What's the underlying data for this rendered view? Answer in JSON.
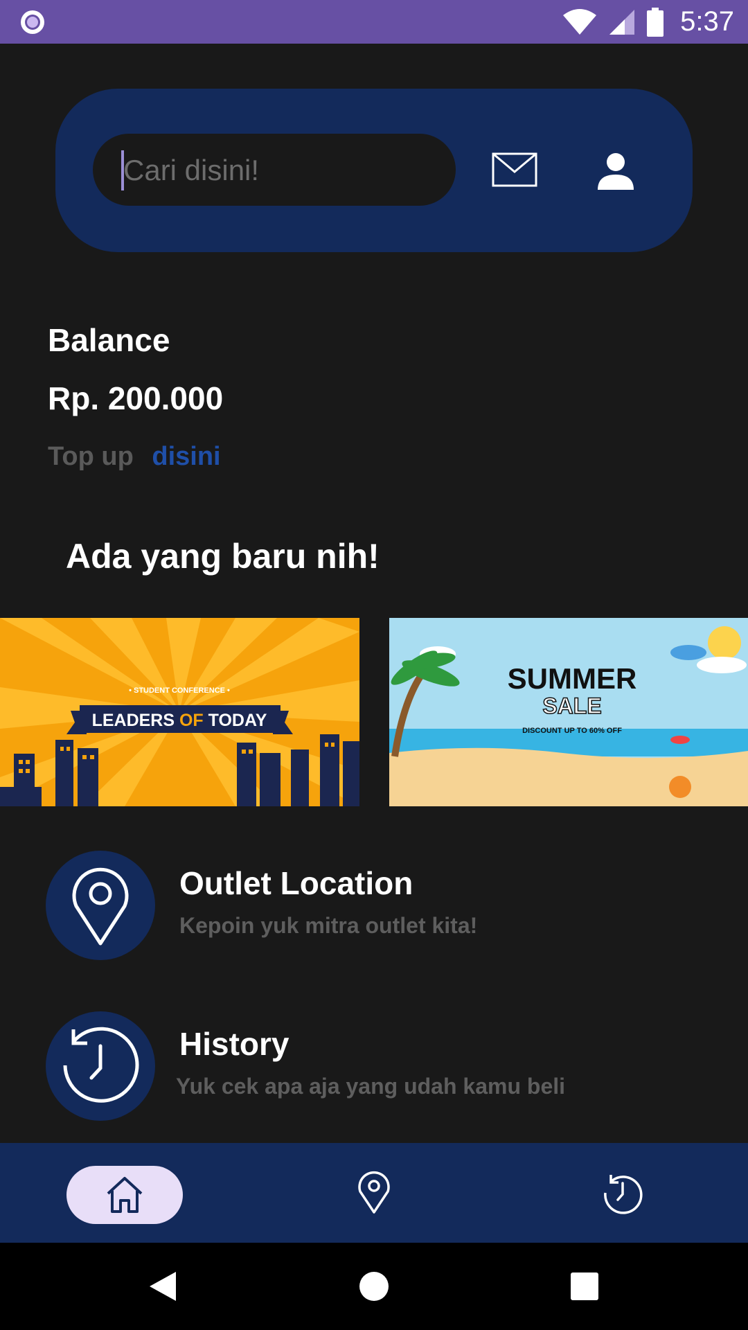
{
  "status_bar": {
    "time": "5:37",
    "icons": [
      "circle-notification-icon",
      "wifi-icon",
      "cell-signal-icon",
      "battery-icon"
    ],
    "color": "#6750a4"
  },
  "header": {
    "search_placeholder": "Cari disini!",
    "mail_icon": "mail-icon",
    "profile_icon": "profile-icon",
    "card_color": "#132a5b"
  },
  "balance": {
    "label": "Balance",
    "value": "Rp. 200.000",
    "topup_text": "Top up",
    "topup_link": "disini",
    "link_color": "#1f4fa8"
  },
  "news": {
    "title": "Ada yang baru nih!",
    "banners": [
      {
        "label_small": "• STUDENT CONFERENCE •",
        "title_part1": "LEADERS ",
        "title_part2": "OF",
        "title_part3": " TODAY"
      },
      {
        "title_line1": "SUMMER",
        "title_line2": "SALE",
        "subtitle": "DISCOUNT UP TO 60% OFF"
      }
    ]
  },
  "menu": [
    {
      "title": "Outlet Location",
      "subtitle": "Kepoin yuk mitra outlet kita!",
      "icon": "location-pin-icon"
    },
    {
      "title": "History",
      "subtitle": "Yuk cek apa aja yang udah kamu beli",
      "icon": "history-clock-icon"
    }
  ],
  "bottom_nav": {
    "items": [
      {
        "icon": "home-icon",
        "active": true
      },
      {
        "icon": "location-pin-icon",
        "active": false
      },
      {
        "icon": "history-clock-icon",
        "active": false
      }
    ]
  },
  "system_nav": [
    "back-icon",
    "home-circle-icon",
    "recents-icon"
  ]
}
